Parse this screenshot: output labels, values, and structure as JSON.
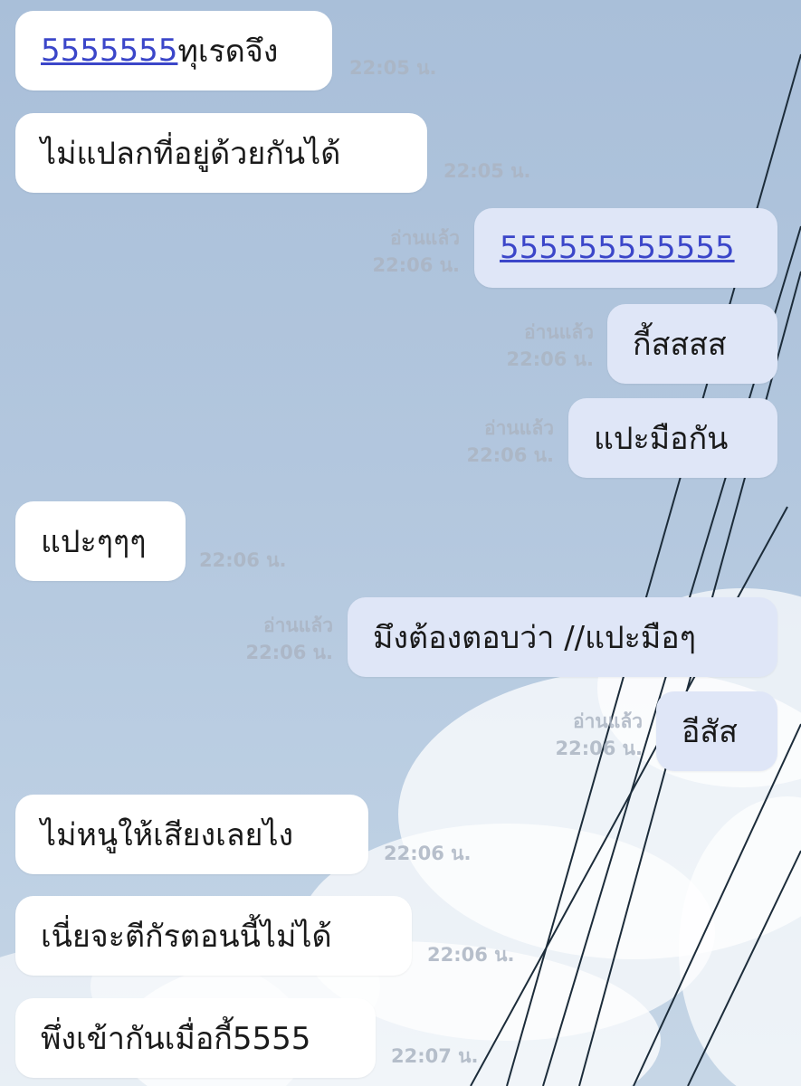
{
  "messages": [
    {
      "side": "in",
      "link": "5555555",
      "text": "ทุเรดจึง",
      "time": "22:05 น."
    },
    {
      "side": "in",
      "text": "ไม่แปลกที่อยู่ด้วยกันได้",
      "time": "22:05 น."
    },
    {
      "side": "out",
      "link": "555555555555",
      "read": "อ่านแล้ว",
      "time": "22:06 น."
    },
    {
      "side": "out",
      "text": "กี้สสสส",
      "read": "อ่านแล้ว",
      "time": "22:06 น."
    },
    {
      "side": "out",
      "text": "แปะมือกัน",
      "read": "อ่านแล้ว",
      "time": "22:06 น."
    },
    {
      "side": "in",
      "text": "แปะๆๆๆ",
      "time": "22:06 น."
    },
    {
      "side": "out",
      "text": "มึงต้องตอบว่า //แปะมือๆ",
      "read": "อ่านแล้ว",
      "time": "22:06 น."
    },
    {
      "side": "out",
      "text": "อีสัส",
      "read": "อ่านแล้ว",
      "time": "22:06 น."
    },
    {
      "side": "in",
      "text": "ไม่หนูให้เสียงเลยไง",
      "time": "22:06 น."
    },
    {
      "side": "in",
      "text": "เนี่ยจะตีกัรตอนนี้ไม่ได้",
      "time": "22:06 น."
    },
    {
      "side": "in",
      "text": "พึ่งเข้ากันเมื่อกี้5555",
      "time": "22:07 น."
    }
  ]
}
